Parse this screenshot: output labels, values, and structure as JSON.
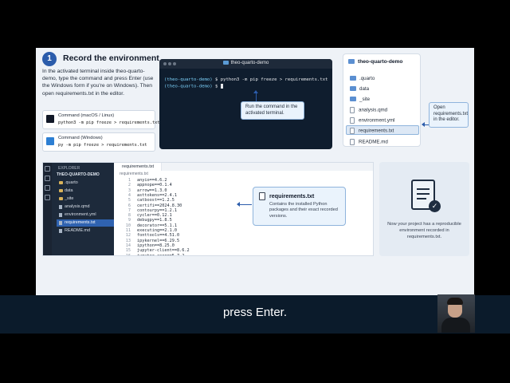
{
  "step": {
    "number": "1",
    "title": "Record the environment",
    "intro": "In the activated terminal inside theo-quarto-demo, type the command and press Enter (use the Windows form if you're on Windows). Then open requirements.txt in the editor."
  },
  "commands": [
    {
      "label": "Command (macOS / Linux)",
      "code": "python3 -m pip freeze > requirements.txt",
      "icon": "terminal-icon"
    },
    {
      "label": "Command (Windows)",
      "code": "py -m pip freeze > requirements.txt",
      "icon": "windows-icon"
    }
  ],
  "terminal": {
    "title": "theo-quarto-demo",
    "line1_env": "(theo-quarto-demo)",
    "line1_cmd": " $ python3 -m pip freeze > requirements.txt",
    "line2_env": "(theo-quarto-demo)",
    "line2_cmd": " $ ",
    "callout": "Run the command in the activated terminal."
  },
  "explorer_card": {
    "title": "theo-quarto-demo",
    "items": [
      {
        "name": ".quarto",
        "kind": "folder"
      },
      {
        "name": "data",
        "kind": "folder"
      },
      {
        "name": "_site",
        "kind": "folder"
      },
      {
        "name": "analysis.qmd",
        "kind": "file"
      },
      {
        "name": "environment.yml",
        "kind": "file"
      },
      {
        "name": "requirements.txt",
        "kind": "file",
        "selected": true
      },
      {
        "name": "README.md",
        "kind": "file"
      }
    ],
    "callout": "Open requirements.txt in the editor."
  },
  "editor": {
    "explorer_label": "EXPLORER",
    "root": "THEO-QUARTO-DEMO",
    "files": [
      ".quarto",
      "data",
      "_site",
      "analysis.qmd",
      "environment.yml",
      "requirements.txt",
      "README.md"
    ],
    "tab": "requirements.txt",
    "breadcrumb": "requirements.txt",
    "lines": [
      "anyio==4.6.2",
      "appnope==0.1.4",
      "arrow==1.3.0",
      "asttokens==2.4.1",
      "catboost==1.2.5",
      "certifi==2024.8.30",
      "contourpy==1.2.1",
      "cycler==0.12.1",
      "debugpy==1.8.5",
      "decorator==5.1.1",
      "executing==2.1.0",
      "fonttools==4.51.0",
      "ipykernel==6.29.5",
      "ipython==8.25.0",
      "jupyter-client==8.6.2",
      "jupyter-core==5.7.2"
    ],
    "callout_title": "requirements.txt",
    "callout_text": "Contains the installed Python packages and their exact recorded versions."
  },
  "done": {
    "text": "Now your project has a reproducible environment recorded in requirements.txt."
  },
  "subtitle": "press Enter."
}
